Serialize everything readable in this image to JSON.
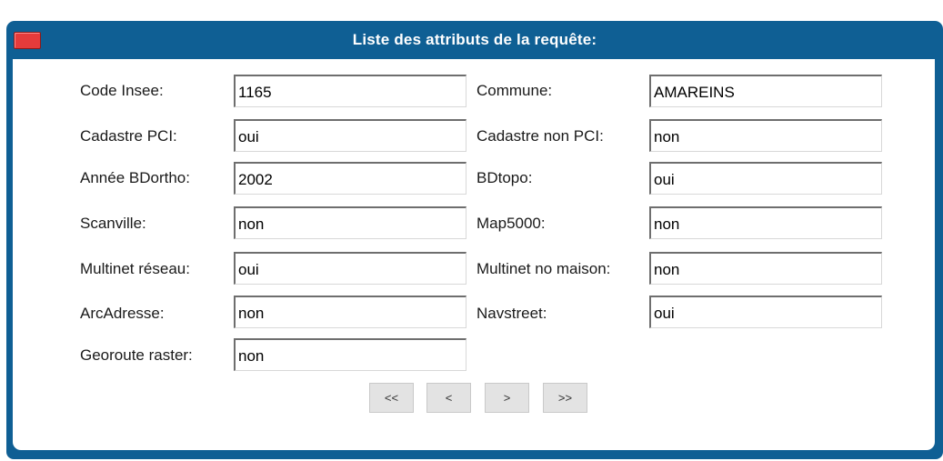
{
  "window": {
    "title": "Liste des attributs de la requête:"
  },
  "fields": [
    {
      "label": "Code Insee:",
      "value": "1165"
    },
    {
      "label": "Commune:",
      "value": "AMAREINS"
    },
    {
      "label": "Cadastre PCI:",
      "value": "oui"
    },
    {
      "label": "Cadastre non PCI:",
      "value": "non"
    },
    {
      "label": "Année BDortho:",
      "value": "2002"
    },
    {
      "label": "BDtopo:",
      "value": "oui"
    },
    {
      "label": "Scanville:",
      "value": "non"
    },
    {
      "label": "Map5000:",
      "value": "non"
    },
    {
      "label": "Multinet réseau:",
      "value": "oui"
    },
    {
      "label": "Multinet no maison:",
      "value": "non"
    },
    {
      "label": "ArcAdresse:",
      "value": "non"
    },
    {
      "label": "Navstreet:",
      "value": "oui"
    },
    {
      "label": "Georoute raster:",
      "value": "non"
    }
  ],
  "pagination": {
    "first": "<<",
    "prev": "<",
    "next": ">",
    "last": ">>"
  }
}
